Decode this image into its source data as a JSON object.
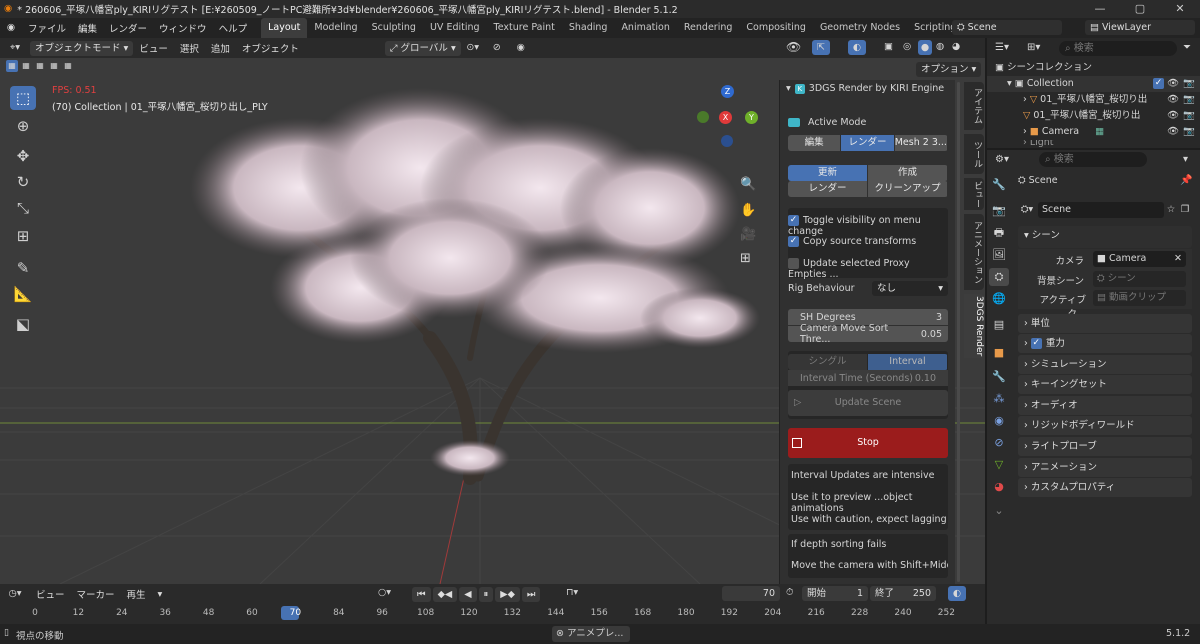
{
  "window": {
    "title": "* 260606_平塚八幡宮ply_KIRIリグテスト [E:¥260509_ノートPC避難所¥3d¥blender¥260606_平塚八幡宮ply_KIRIリグテスト.blend] - Blender 5.1.2",
    "minimize": "—",
    "maximize": "▢",
    "close": "✕"
  },
  "menus": [
    "ファイル",
    "編集",
    "レンダー",
    "ウィンドウ",
    "ヘルプ"
  ],
  "workspaces": [
    "Layout",
    "Modeling",
    "Sculpting",
    "UV Editing",
    "Texture Paint",
    "Shading",
    "Animation",
    "Rendering",
    "Compositing",
    "Geometry Nodes",
    "Scripting"
  ],
  "active_workspace": "Layout",
  "scene_selector": "Scene",
  "view_layer": "ViewLayer",
  "viewport_header": {
    "mode": "オブジェクトモード",
    "menus": [
      "ビュー",
      "選択",
      "追加",
      "オブジェクト"
    ],
    "orientation": "グローバル",
    "options": "オプション"
  },
  "overlay": {
    "fps": "FPS: 0.51",
    "info": "(70) Collection | 01_平塚八幡宮_桜切り出し_PLY"
  },
  "gizmo": {
    "z": "Z",
    "x": "X",
    "y": "Y"
  },
  "npanel": {
    "title": "3DGS Render by KIRI Engine",
    "active_mode": "Active Mode",
    "mode_tabs": [
      "編集",
      "レンダー",
      "Mesh 2 3..."
    ],
    "mode_active": 1,
    "update_grid": [
      "更新",
      "作成",
      "レンダー",
      "クリーンアップ"
    ],
    "checks": [
      {
        "label": "Toggle visibility on menu change",
        "on": true
      },
      {
        "label": "Copy source transforms",
        "on": true
      },
      {
        "label": "Update selected Proxy Empties ...",
        "on": false
      }
    ],
    "rig_label": "Rig Behaviour",
    "rig_value": "なし",
    "sh_label": "SH Degrees",
    "sh_value": "3",
    "sort_label": "Camera Move Sort Thre...",
    "sort_value": "0.05",
    "interval_tabs": [
      "シングル",
      "Interval"
    ],
    "interval_time_label": "Interval Time (Seconds)",
    "interval_time_value": "0.10",
    "update_scene": "Update Scene",
    "stop": "Stop",
    "notes1": [
      "Interval Updates are intensive",
      "Use it to preview ...object animations",
      "Use with caution, expect lagging"
    ],
    "notes2": [
      "If depth sorting fails",
      "Move the camera with Shift+Middle ..."
    ]
  },
  "vtabs": [
    "アイテム",
    "ツール",
    "ビュー",
    "アニメーション",
    "3DGS Render"
  ],
  "timeline": {
    "menus": [
      "ビュー",
      "マーカー",
      "再生"
    ],
    "current": "70",
    "start_label": "開始",
    "start": "1",
    "end_label": "終了",
    "end": "250",
    "ticks": [
      "0",
      "12",
      "24",
      "36",
      "48",
      "60",
      "70",
      "84",
      "96",
      "108",
      "120",
      "132",
      "144",
      "156",
      "168",
      "180",
      "192",
      "204",
      "216",
      "228",
      "240",
      "252"
    ]
  },
  "status": {
    "left": "視点の移動",
    "popup": "アニメプレ...",
    "version": "5.1.2"
  },
  "outliner": {
    "search": "検索",
    "root": "シーンコレクション",
    "collection": "Collection",
    "items": [
      "01_平塚八幡宮_桜切り出",
      "01_平塚八幡宮_桜切り出",
      "Camera",
      "Light"
    ]
  },
  "properties": {
    "search": "検索",
    "scene_name": "Scene",
    "scene_field": "Scene",
    "section": "シーン",
    "camera_label": "カメラ",
    "camera_value": "Camera",
    "bg_label": "背景シーン",
    "bg_value": "シーン",
    "clip_label": "アクティブク...",
    "clip_value": "動画クリップ",
    "sections": [
      "単位",
      "重力",
      "シミュレーション",
      "キーイングセット",
      "オーディオ",
      "リジッドボディワールド",
      "ライトプローブ",
      "アニメーション",
      "カスタムプロパティ"
    ]
  },
  "colors": {
    "accent": "#4772b3",
    "stop": "#9b1c1c",
    "fps": "#e04040",
    "timeline_cursor": "#4772b3"
  }
}
